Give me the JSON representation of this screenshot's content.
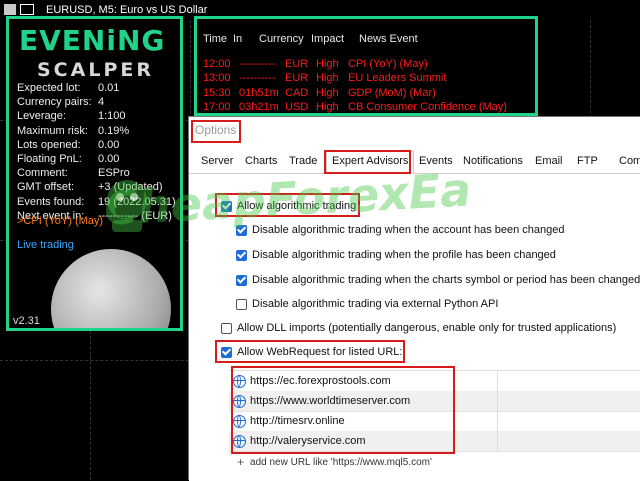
{
  "window": {
    "title": "EURUSD, M5:  Euro vs US Dollar"
  },
  "ea_panel": {
    "logo_line1": "EVENiNG",
    "logo_line2": "SCALPER",
    "stats": [
      {
        "label": "Expected lot:",
        "value": "0.01"
      },
      {
        "label": "Currency pairs:",
        "value": "4"
      },
      {
        "label": "Leverage:",
        "value": "1:100"
      },
      {
        "label": "Maximum risk:",
        "value": "0.19%"
      },
      {
        "label": "Lots opened:",
        "value": "0.00"
      },
      {
        "label": "Floating PnL:",
        "value": "0.00"
      },
      {
        "label": "Comment:",
        "value": "ESPro"
      },
      {
        "label": "GMT offset:",
        "value": "+3 (Updated)"
      },
      {
        "label": "Events found:",
        "value": "19 (2022.05.31)"
      },
      {
        "label": "Next event in:",
        "value": "----------- (EUR)"
      }
    ],
    "next_event_line": ">CPI (YoY) (May)",
    "status": "Live trading",
    "version": "v2.31",
    "accent_color": "#1fd38a"
  },
  "news": {
    "headers": [
      "Time",
      "In",
      "Currency",
      "Impact",
      "News Event"
    ],
    "rows": [
      {
        "time": "12:00",
        "in": "----------",
        "currency": "EUR",
        "impact": "High",
        "event": "CPI (YoY) (May)"
      },
      {
        "time": "13:00",
        "in": "----------",
        "currency": "EUR",
        "impact": "High",
        "event": "EU Leaders Summit"
      },
      {
        "time": "15:30",
        "in": "01h51m",
        "currency": "CAD",
        "impact": "High",
        "event": "GDP (MoM) (Mar)"
      },
      {
        "time": "17:00",
        "in": "03h21m",
        "currency": "USD",
        "impact": "High",
        "event": "CB Consumer Confidence (May)"
      }
    ],
    "row_color": "#ff1a1a"
  },
  "options_dialog": {
    "title": "Options",
    "tabs": [
      "Server",
      "Charts",
      "Trade",
      "Expert Advisors",
      "Events",
      "Notifications",
      "Email",
      "FTP",
      "Com"
    ],
    "active_tab": "Expert Advisors",
    "options": [
      {
        "label": "Allow algorithmic trading",
        "checked": true
      },
      {
        "label": "Disable algorithmic trading when the account has been changed",
        "checked": true
      },
      {
        "label": "Disable algorithmic trading when the profile has been changed",
        "checked": true
      },
      {
        "label": "Disable algorithmic trading when the charts symbol or period has been changed",
        "checked": true
      },
      {
        "label": "Disable algorithmic trading via external Python API",
        "checked": false
      },
      {
        "label": "Allow DLL imports (potentially dangerous, enable only for trusted applications)",
        "checked": false
      },
      {
        "label": "Allow WebRequest for listed URL:",
        "checked": true
      }
    ],
    "urls": [
      "https://ec.forexprostools.com",
      "https://www.worldtimeserver.com",
      "http://timesrv.online",
      "http://valeryservice.com"
    ],
    "add_url_placeholder": "add new URL like 'https://www.mql5.com'"
  },
  "watermark": {
    "text": "CheapForexEa"
  }
}
